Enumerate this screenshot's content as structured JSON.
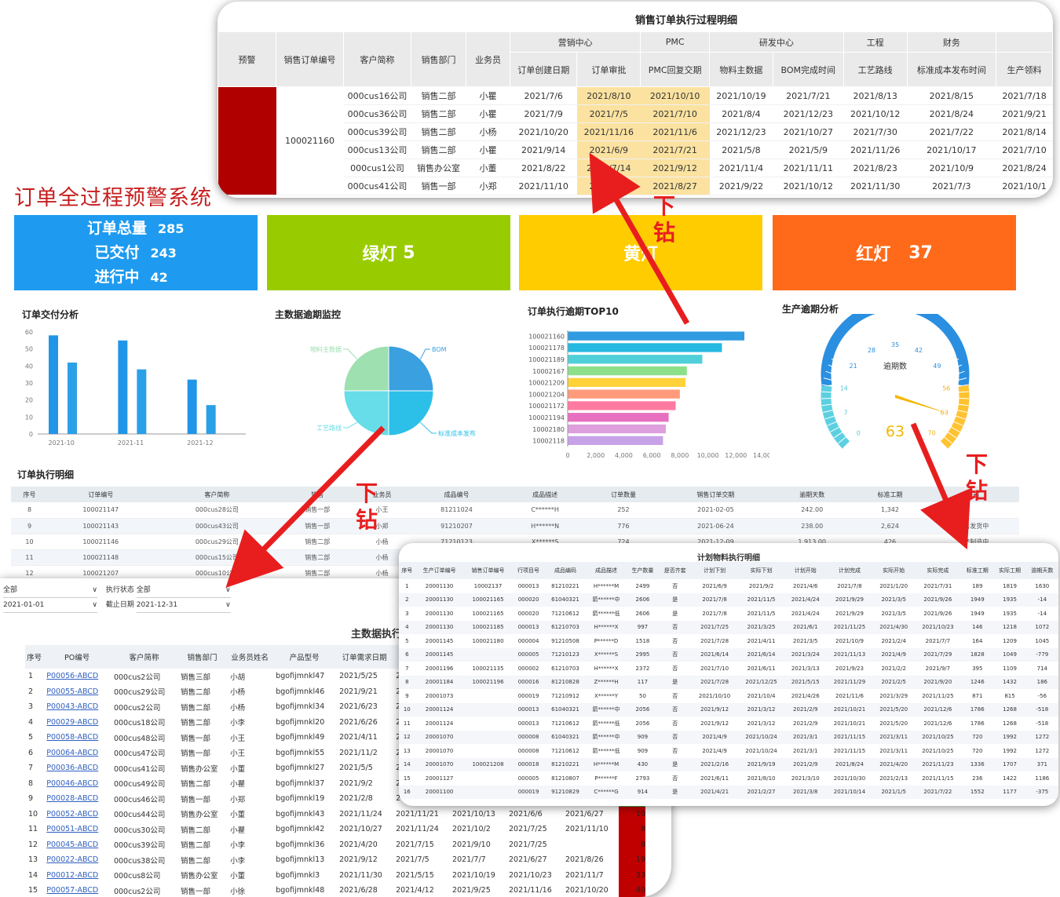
{
  "page_title": "订单全过程预警系统",
  "kpis": {
    "total_label": "订单总量",
    "total_value": "285",
    "delivered_label": "已交付",
    "delivered_value": "243",
    "ongoing_label": "进行中",
    "ongoing_value": "42",
    "green_label": "绿灯",
    "green_value": "5",
    "yellow_label": "黄灯",
    "red_label": "红灯",
    "red_value": "37"
  },
  "sections": {
    "delivery": "订单交付分析",
    "master": "主数据逾期监控",
    "top10": "订单执行逾期TOP10",
    "production": "生产逾期分析",
    "detail": "订单执行明细"
  },
  "drill_label_1": "下",
  "drill_label_2": "钻",
  "gauge_label": "逾期数",
  "gauge_value": "63",
  "chart_data": [
    {
      "type": "bar",
      "title": "订单交付分析",
      "categories": [
        "2021-10",
        "2021-11",
        "2021-12"
      ],
      "series": [
        {
          "values": [
            58,
            55,
            32
          ]
        },
        {
          "values": [
            42,
            38,
            17
          ]
        }
      ],
      "ylim": [
        0,
        60
      ],
      "yticks": [
        0,
        10,
        20,
        30,
        40,
        50,
        60
      ]
    },
    {
      "type": "pie",
      "title": "主数据逾期监控",
      "labels": [
        "BOM",
        "标准成本发布",
        "工艺路线",
        "物料主数据"
      ],
      "values": [
        25,
        25,
        25,
        25
      ],
      "colors": [
        "#3aa0e0",
        "#2cc0e8",
        "#66dde8",
        "#9ee0b0"
      ]
    },
    {
      "type": "bar",
      "orientation": "horizontal",
      "title": "订单执行逾期TOP10",
      "categories": [
        "100021160",
        "100021178",
        "100021189",
        "10002167",
        "100021209",
        "100021204",
        "100021172",
        "100021194",
        "10002180",
        "10002118"
      ],
      "values": [
        12600,
        11000,
        9600,
        8500,
        8400,
        8000,
        7700,
        7200,
        7000,
        6800
      ],
      "colors": [
        "#2f9be0",
        "#25b8e0",
        "#4fd0d8",
        "#8de08a",
        "#ffd23a",
        "#ff9b7a",
        "#ff7aa0",
        "#e76fc0",
        "#dda0dd",
        "#c8a2e8"
      ],
      "xlim": [
        0,
        14000
      ],
      "xticks": [
        0,
        2000,
        4000,
        6000,
        8000,
        10000,
        12000,
        14000
      ]
    },
    {
      "type": "gauge",
      "title": "生产逾期分析",
      "value": 63,
      "min": 0,
      "max": 70,
      "ticks": [
        0,
        7,
        14,
        21,
        28,
        35,
        42,
        49,
        56,
        63,
        70
      ]
    }
  ],
  "detail_table": {
    "headers": [
      "序号",
      "订单编号",
      "客户简称",
      "销售",
      "业务员",
      "成品编号",
      "成品描述",
      "订单数量",
      "销售订单交期",
      "逾期天数",
      "标准工期",
      "当前"
    ],
    "rows": [
      [
        "8",
        "100021147",
        "000cus28公司",
        "销售一部",
        "小王",
        "81211024",
        "C******H",
        "252",
        "2021-02-05",
        "242.00",
        "1,342",
        ""
      ],
      [
        "9",
        "100021143",
        "000cus43公司",
        "销售一部",
        "小郑",
        "91210207",
        "H******N",
        "776",
        "2021-06-24",
        "238.00",
        "2,624",
        "销售发货中"
      ],
      [
        "10",
        "100021146",
        "000cus29公司",
        "销售二部",
        "小杨",
        "71210123",
        "X******S",
        "724",
        "2021-12-09",
        "1,913.00",
        "426",
        "生产制造中"
      ],
      [
        "11",
        "100021148",
        "000cus15公司",
        "销售二部",
        "小杨",
        "",
        "",
        "",
        "",
        "",
        "",
        ""
      ],
      [
        "12",
        "100021207",
        "000cus10公司",
        "销售二部",
        "小杨",
        "",
        "",
        "",
        "",
        "",
        "",
        ""
      ]
    ]
  },
  "sales_card": {
    "title": "销售订单执行过程明细",
    "groups": [
      "营销中心",
      "PMC",
      "研发中心",
      "工程",
      "财务"
    ],
    "headers": [
      "预警",
      "销售订单编号",
      "客户简称",
      "销售部门",
      "业务员",
      "订单创建日期",
      "订单审批",
      "PMC回复交期",
      "物料主数据",
      "BOM完成时间",
      "工艺路线",
      "标准成本发布时间",
      "生产领料"
    ],
    "order_no": "100021160",
    "rows": [
      [
        "000cus16公司",
        "销售二部",
        "小瞿",
        "2021/7/6",
        "2021/8/10",
        "2021/10/10",
        "2021/10/19",
        "2021/7/21",
        "2021/8/13",
        "2021/8/15",
        "2021/7/18"
      ],
      [
        "000cus36公司",
        "销售二部",
        "小瞿",
        "2021/7/9",
        "2021/7/5",
        "2021/7/10",
        "2021/8/4",
        "2021/12/23",
        "2021/10/12",
        "2021/8/24",
        "2021/9/21"
      ],
      [
        "000cus39公司",
        "销售二部",
        "小杨",
        "2021/10/20",
        "2021/11/16",
        "2021/11/6",
        "2021/12/23",
        "2021/10/27",
        "2021/7/30",
        "2021/7/22",
        "2021/8/14"
      ],
      [
        "000cus13公司",
        "销售二部",
        "小瞿",
        "2021/9/14",
        "2021/6/9",
        "2021/7/21",
        "2021/5/8",
        "2021/5/9",
        "2021/11/26",
        "2021/10/17",
        "2021/7/10"
      ],
      [
        "000cus1公司",
        "销售办公室",
        "小董",
        "2021/8/22",
        "2021/7/14",
        "2021/9/12",
        "2021/11/4",
        "2021/11/11",
        "2021/8/23",
        "2021/10/9",
        "2021/8/24"
      ],
      [
        "000cus41公司",
        "销售一部",
        "小郑",
        "2021/11/10",
        "2021/7/4",
        "2021/8/27",
        "2021/9/22",
        "2021/10/12",
        "2021/11/30",
        "2021/7/3",
        "2021/10/1"
      ]
    ]
  },
  "master_card": {
    "filter1_label": "全部",
    "filter_state_label": "执行状态",
    "filter_state_value": "全部",
    "filter_start_value": "2021-01-01",
    "filter_end_label": "截止日期",
    "filter_end_value": "2021-12-31",
    "title": "主数据执行情况",
    "headers": [
      "序号",
      "PO编号",
      "客户简称",
      "销售部门",
      "业务员姓名",
      "产品型号",
      "订单需求日期",
      "物"
    ],
    "rows": [
      [
        "1",
        "P00056-ABCD",
        "000cus2公司",
        "销售三部",
        "小胡",
        "bgofijmnkl47",
        "2021/5/25",
        "202",
        "",
        "",
        "",
        "g"
      ],
      [
        "2",
        "P00055-ABCD",
        "000cus29公司",
        "销售二部",
        "小杨",
        "bgofijmnkl46",
        "2021/9/21",
        "202",
        "",
        "",
        "",
        "g"
      ],
      [
        "3",
        "P00043-ABCD",
        "000cus2公司",
        "销售二部",
        "小杨",
        "bgofijmnkl34",
        "2021/6/23",
        "202",
        "",
        "",
        "",
        "g"
      ],
      [
        "4",
        "P00029-ABCD",
        "000cus18公司",
        "销售二部",
        "小李",
        "bgofijmnkl20",
        "2021/6/26",
        "202",
        "",
        "",
        "",
        "g"
      ],
      [
        "5",
        "P00058-ABCD",
        "000cus48公司",
        "销售一部",
        "小王",
        "bgofijmnkl49",
        "2021/4/11",
        "202",
        "",
        "",
        "",
        "g"
      ],
      [
        "6",
        "P00064-ABCD",
        "000cus47公司",
        "销售一部",
        "小王",
        "bgofijmnkl55",
        "2021/11/2",
        "202",
        "",
        "",
        "",
        "g"
      ],
      [
        "7",
        "P00036-ABCD",
        "000cus41公司",
        "销售办公室",
        "小董",
        "bgofijmnkl27",
        "2021/5/5",
        "202",
        "",
        "",
        "",
        "g"
      ],
      [
        "8",
        "P00046-ABCD",
        "000cus49公司",
        "销售二部",
        "小瞿",
        "bgofijmnkl37",
        "2021/9/2",
        "202",
        "",
        "",
        "",
        "g"
      ],
      [
        "9",
        "P00028-ABCD",
        "000cus46公司",
        "销售一部",
        "小郑",
        "bgofijmnkl19",
        "2021/2/8",
        "2021/11/",
        "",
        "",
        "",
        "g"
      ],
      [
        "10",
        "P00052-ABCD",
        "000cus44公司",
        "销售办公室",
        "小董",
        "bgofijmnkl43",
        "2021/11/24",
        "2021/11/21",
        "2021/10/13",
        "2021/6/6",
        "2021/6/27",
        "10"
      ],
      [
        "11",
        "P00051-ABCD",
        "000cus30公司",
        "销售二部",
        "小瞿",
        "bgofijmnkl42",
        "2021/10/27",
        "2021/11/24",
        "2021/10/2",
        "2021/7/25",
        "2021/11/10",
        "8"
      ],
      [
        "12",
        "P00045-ABCD",
        "000cus39公司",
        "销售二部",
        "小李",
        "bgofijmnkl36",
        "2021/4/20",
        "2021/7/15",
        "2021/9/10",
        "2021/7/25",
        "",
        "8"
      ],
      [
        "13",
        "P00022-ABCD",
        "000cus38公司",
        "销售二部",
        "小李",
        "bgofijmnkl13",
        "2021/9/12",
        "2021/7/5",
        "2021/7/7",
        "2021/6/27",
        "2021/8/26",
        "19"
      ],
      [
        "14",
        "P00012-ABCD",
        "000cus8公司",
        "销售办公室",
        "小董",
        "bgofijmnkl3",
        "2021/11/30",
        "2021/5/15",
        "2021/10/19",
        "2021/10/23",
        "2021/11/7",
        "33"
      ],
      [
        "15",
        "P00057-ABCD",
        "000cus2公司",
        "销售一部",
        "小徐",
        "bgofijmnkl48",
        "2021/6/28",
        "2021/4/12",
        "2021/9/25",
        "2021/11/16",
        "2021/10/20",
        "40"
      ]
    ]
  },
  "plan_card": {
    "title": "计划物料执行明细",
    "headers": [
      "序号",
      "生产订单编号",
      "销售订单编号",
      "行项目号",
      "成品编码",
      "成品描述",
      "生产数量",
      "是否齐套",
      "计划下划",
      "实际下划",
      "计划开始",
      "计划完成",
      "实际开始",
      "实际完成",
      "标准工期",
      "实际工期",
      "逾期天数"
    ],
    "rows": [
      [
        "1",
        "20001130",
        "10002137",
        "000013",
        "81210221",
        "H******M",
        "2499",
        "否",
        "2021/6/9",
        "2021/9/2",
        "2021/4/6",
        "2021/7/8",
        "2021/1/20",
        "2021/7/31",
        "189",
        "1819",
        "1630"
      ],
      [
        "2",
        "20001130",
        "100021165",
        "000020",
        "61040321",
        "箭******中",
        "2606",
        "是",
        "2021/7/8",
        "2021/11/5",
        "2021/4/24",
        "2021/9/29",
        "2021/3/5",
        "2021/9/26",
        "1949",
        "1935",
        "-14"
      ],
      [
        "3",
        "20001130",
        "100021165",
        "000020",
        "71210612",
        "箭******低",
        "2606",
        "是",
        "2021/7/8",
        "2021/11/5",
        "2021/4/24",
        "2021/9/29",
        "2021/3/5",
        "2021/9/26",
        "1949",
        "1935",
        "-14"
      ],
      [
        "4",
        "20001130",
        "100021185",
        "000013",
        "61210703",
        "H******X",
        "997",
        "否",
        "2021/7/25",
        "2021/3/25",
        "2021/6/1",
        "2021/11/25",
        "2021/4/30",
        "2021/10/23",
        "146",
        "1218",
        "1072"
      ],
      [
        "5",
        "20001145",
        "100021180",
        "000004",
        "91210508",
        "P******D",
        "1518",
        "否",
        "2021/7/28",
        "2021/4/11",
        "2021/3/5",
        "2021/10/9",
        "2021/2/4",
        "2021/7/7",
        "164",
        "1209",
        "1045"
      ],
      [
        "6",
        "20001145",
        "",
        "000005",
        "71210123",
        "X******S",
        "2995",
        "否",
        "2021/6/14",
        "2021/6/14",
        "2021/3/24",
        "2021/11/13",
        "2021/4/9",
        "2021/7/29",
        "1828",
        "1049",
        "-779"
      ],
      [
        "7",
        "20001196",
        "100021135",
        "000002",
        "61210703",
        "H******X",
        "2372",
        "否",
        "2021/7/10",
        "2021/6/11",
        "2021/3/13",
        "2021/9/23",
        "2021/2/2",
        "2021/9/7",
        "395",
        "1109",
        "714"
      ],
      [
        "8",
        "20001184",
        "100021196",
        "000016",
        "81210828",
        "Z******H",
        "117",
        "是",
        "2021/7/28",
        "2021/12/25",
        "2021/5/15",
        "2021/11/29",
        "2021/2/5",
        "2021/9/20",
        "1246",
        "1432",
        "186"
      ],
      [
        "9",
        "20001073",
        "",
        "000019",
        "71210912",
        "X******Y",
        "50",
        "否",
        "2021/10/10",
        "2021/10/4",
        "2021/4/26",
        "2021/11/6",
        "2021/3/29",
        "2021/11/25",
        "871",
        "815",
        "-56"
      ],
      [
        "10",
        "20001124",
        "",
        "000013",
        "61040321",
        "箭******中",
        "2056",
        "否",
        "2021/9/12",
        "2021/3/12",
        "2021/2/9",
        "2021/10/21",
        "2021/5/20",
        "2021/12/6",
        "1786",
        "1268",
        "-518"
      ],
      [
        "11",
        "20001124",
        "",
        "000013",
        "71210612",
        "箭******低",
        "2056",
        "否",
        "2021/9/12",
        "2021/3/12",
        "2021/2/9",
        "2021/10/21",
        "2021/5/20",
        "2021/12/6",
        "1786",
        "1268",
        "-518"
      ],
      [
        "12",
        "20001070",
        "",
        "000008",
        "61040321",
        "箭******中",
        "909",
        "否",
        "2021/4/9",
        "2021/10/24",
        "2021/3/1",
        "2021/11/15",
        "2021/3/11",
        "2021/10/25",
        "720",
        "1992",
        "1272"
      ],
      [
        "13",
        "20001070",
        "",
        "000008",
        "71210612",
        "箭******低",
        "909",
        "否",
        "2021/4/9",
        "2021/10/24",
        "2021/3/1",
        "2021/11/15",
        "2021/3/11",
        "2021/10/25",
        "720",
        "1992",
        "1272"
      ],
      [
        "14",
        "20001070",
        "100021208",
        "000018",
        "81210221",
        "H******M",
        "430",
        "是",
        "2021/2/16",
        "2021/9/19",
        "2021/2/9",
        "2021/8/24",
        "2021/4/20",
        "2021/11/23",
        "1336",
        "1707",
        "371"
      ],
      [
        "15",
        "20001127",
        "",
        "000005",
        "81210807",
        "P******F",
        "2793",
        "否",
        "2021/6/11",
        "2021/8/10",
        "2021/3/10",
        "2021/10/30",
        "2021/2/13",
        "2021/11/15",
        "236",
        "1422",
        "1186"
      ],
      [
        "16",
        "20001100",
        "",
        "000019",
        "91210829",
        "C******G",
        "914",
        "是",
        "2021/4/21",
        "2021/2/27",
        "2021/3/8",
        "2021/10/14",
        "2021/1/5",
        "2021/7/22",
        "1552",
        "1177",
        "-375"
      ]
    ]
  }
}
